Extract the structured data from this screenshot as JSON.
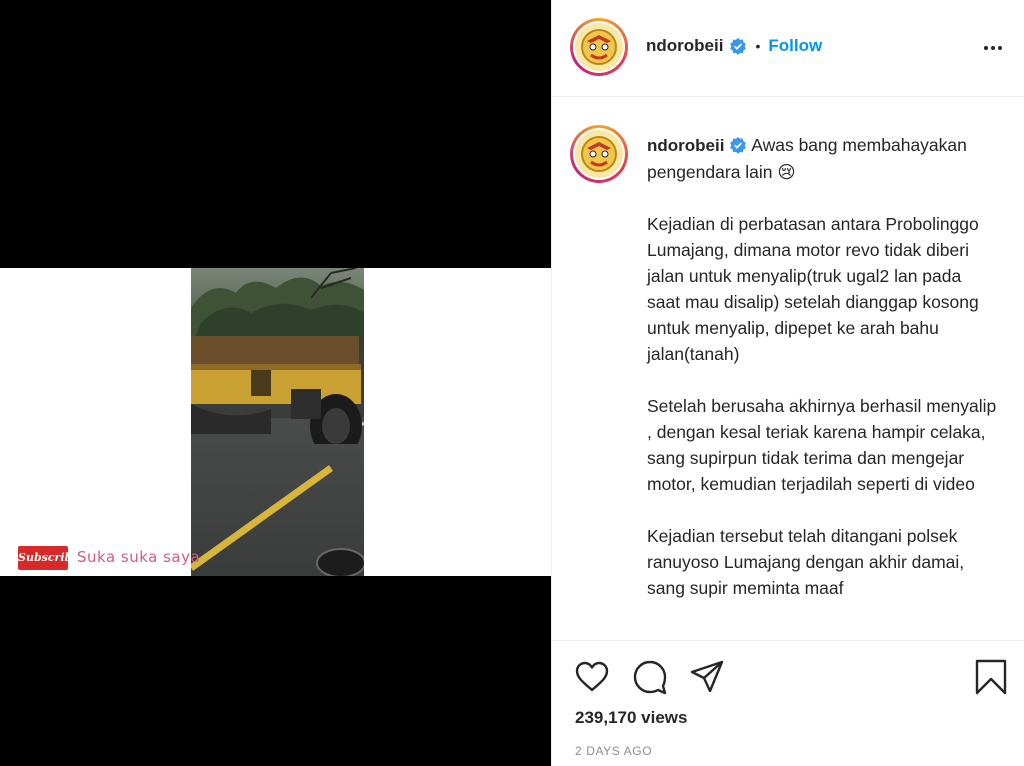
{
  "post": {
    "username": "ndorobeii",
    "follow_label": "Follow",
    "separator": "•",
    "caption_text": " Awas bang membahayakan pengendara lain 😢\n\nKejadian di perbatasan antara Probolinggo Lumajang, dimana motor revo tidak diberi jalan untuk menyalip(truk ugal2 lan pada saat mau disalip) setelah dianggap kosong untuk menyalip, dipepet ke arah bahu jalan(tanah)\n\nSetelah berusaha akhirnya berhasil menyalip , dengan kesal teriak karena hampir celaka, sang supirpun tidak terima dan mengejar motor, kemudian terjadilah seperti di video\n\nKejadian tersebut telah ditangani polsek ranuyoso Lumajang dengan akhir damai, sang supir meminta maaf",
    "views": "239,170 views",
    "time_ago": "2 DAYS AGO"
  },
  "video": {
    "subscribe_label": "Subscribe",
    "watermark": "Suka suka saya"
  },
  "colors": {
    "accent": "#0095f6",
    "verified": "#3897f0",
    "text": "#262626",
    "muted": "#8e8e8e"
  },
  "icons": [
    "verified-badge-icon",
    "more-options-icon",
    "heart-icon",
    "comment-icon",
    "share-icon",
    "bookmark-icon"
  ]
}
